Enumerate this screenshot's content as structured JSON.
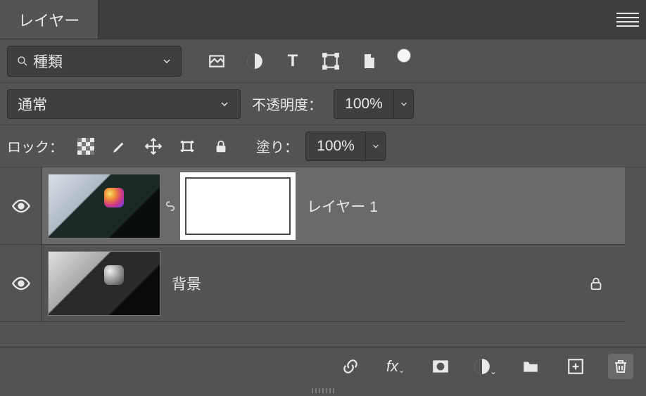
{
  "panel": {
    "title": "レイヤー"
  },
  "filter": {
    "kind_label": "種類",
    "icons": [
      "image-filter",
      "adjustment-filter",
      "type-filter",
      "shape-filter",
      "smartobject-filter"
    ]
  },
  "blend": {
    "mode": "通常",
    "opacity_label": "不透明度：",
    "opacity_value": "100%"
  },
  "lock": {
    "label": "ロック：",
    "fill_label": "塗り：",
    "fill_value": "100%"
  },
  "layers": [
    {
      "name": "レイヤー 1",
      "visible": true,
      "selected": true,
      "has_mask": true,
      "locked": false,
      "thumb_style": "color"
    },
    {
      "name": "背景",
      "visible": true,
      "selected": false,
      "has_mask": false,
      "locked": true,
      "thumb_style": "gray"
    }
  ],
  "bottom_icons": [
    "link",
    "fx",
    "mask",
    "adjustment",
    "group",
    "new",
    "trash"
  ]
}
